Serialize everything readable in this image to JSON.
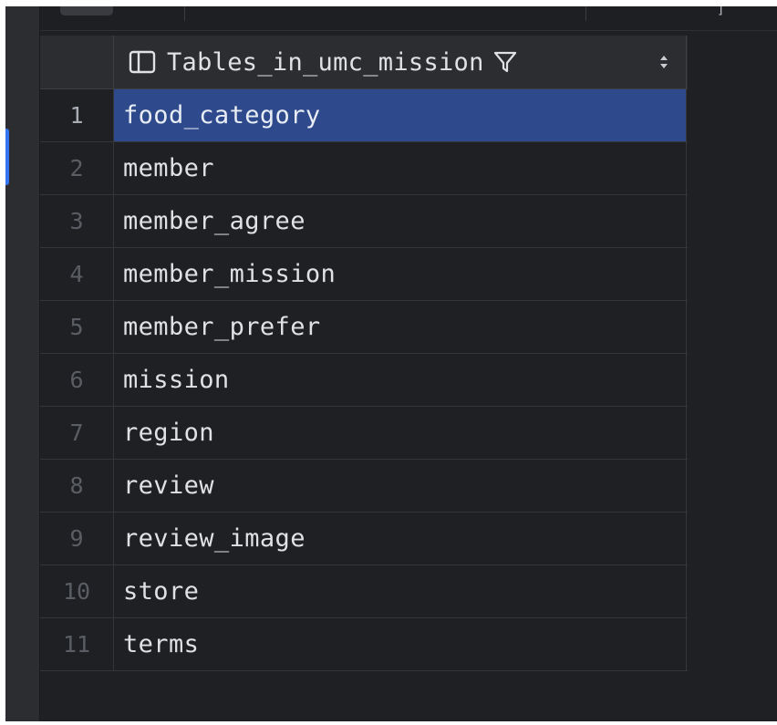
{
  "grid": {
    "column_header": "Tables_in_umc_mission",
    "column_icon": "table-column-icon",
    "filter_icon": "filter-icon",
    "sort_icon": "sort-arrows-icon",
    "rows": [
      {
        "num": "1",
        "value": "food_category"
      },
      {
        "num": "2",
        "value": "member"
      },
      {
        "num": "3",
        "value": "member_agree"
      },
      {
        "num": "4",
        "value": "member_mission"
      },
      {
        "num": "5",
        "value": "member_prefer"
      },
      {
        "num": "6",
        "value": "mission"
      },
      {
        "num": "7",
        "value": "region"
      },
      {
        "num": "8",
        "value": "review"
      },
      {
        "num": "9",
        "value": "review_image"
      },
      {
        "num": "10",
        "value": "store"
      },
      {
        "num": "11",
        "value": "terms"
      }
    ],
    "selected_row": "1"
  },
  "toolbar": {
    "glyph": "]"
  },
  "colors": {
    "background": "#1f2023",
    "header": "#2b2d30",
    "selection": "#2e4a8d",
    "accent": "#3574f0",
    "text": "#dfe1e5"
  }
}
